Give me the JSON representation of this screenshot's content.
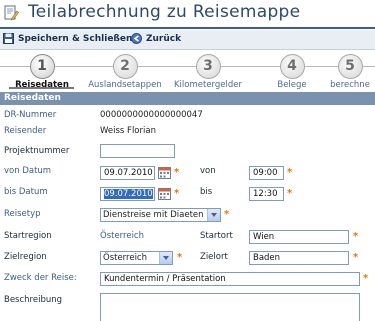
{
  "header": {
    "title": "Teilabrechnung zu Reisemappe"
  },
  "toolbar": {
    "save_label": "Speichern & Schließen",
    "back_label": "Zurück"
  },
  "steps": [
    {
      "number": "1",
      "label": "Reisedaten",
      "active": true
    },
    {
      "number": "2",
      "label": "Auslandsetappen",
      "active": false
    },
    {
      "number": "3",
      "label": "Kilometergelder",
      "active": false
    },
    {
      "number": "4",
      "label": "Belege",
      "active": false
    },
    {
      "number": "5",
      "label": "berechne",
      "active": false
    }
  ],
  "section": {
    "title": "Reisedaten"
  },
  "form": {
    "dr_label": "DR-Nummer",
    "dr_value": "0000000000000000047",
    "reisender_label": "Reisender",
    "reisender_value": "Weiss Florian",
    "projekt_label": "Projektnummer",
    "projekt_value": "",
    "von_datum_label": "von Datum",
    "von_datum_value": "09.07.2010",
    "von_label": "von",
    "von_value": "09:00",
    "bis_datum_label": "bis Datum",
    "bis_datum_value": "09.07.2010",
    "bis_label": "bis",
    "bis_value": "12:30",
    "reisetyp_label": "Reisetyp",
    "reisetyp_value": "Dienstreise mit Diaeten",
    "startregion_label": "Startregion",
    "startregion_value": "Österreich",
    "startort_label": "Startort",
    "startort_value": "Wien",
    "zielregion_label": "Zielregion",
    "zielregion_value": "Österreich",
    "zielort_label": "Zielort",
    "zielort_value": "Baden",
    "zweck_label": "Zweck der Reise:",
    "zweck_value": "Kundentermin / Präsentation",
    "beschreibung_label": "Beschreibung",
    "required_mark": "*"
  },
  "colors": {
    "accent": "#2a4a72",
    "section": "#7b92ae",
    "required": "#e07a00",
    "label": "#3c5d8a"
  }
}
